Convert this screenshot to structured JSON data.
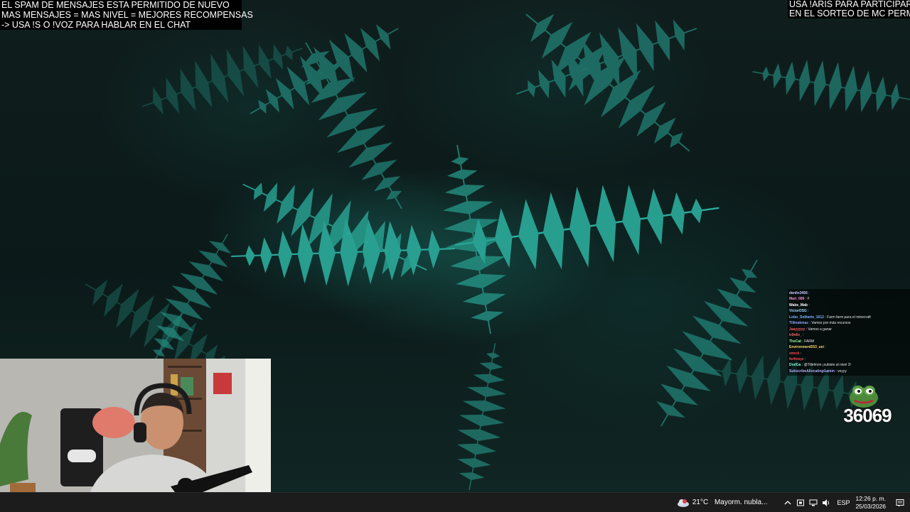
{
  "overlay_left": {
    "lines": [
      "EL SPAM DE MENSAJES ESTA PERMITIDO DE NUEVO",
      "MAS MENSAJES = MAS NIVEL = MEJORES RECOMPENSAS",
      "-> USA !S  O !VOZ PARA HABLAR EN EL CHAT"
    ]
  },
  "overlay_right": {
    "lines": [
      "USA !ARIS PARA PARTICIPAR",
      "EN EL SORTEO DE MC PERMA"
    ]
  },
  "chat": {
    "messages": [
      {
        "user": "danilo3456",
        "text": "",
        "color": "#c9c9ff"
      },
      {
        "user": "Mari_089",
        "text": "F",
        "color": "#ff8ad8"
      },
      {
        "user": "Wabs_Mab",
        "text": "",
        "color": "#ffffff"
      },
      {
        "user": "VictorDSG",
        "text": "",
        "color": "#9fd6ff"
      },
      {
        "user": "Lobo_Solitario_1012",
        "text": "Farm farm para el minecraft",
        "color": "#7ab8ff"
      },
      {
        "user": "Tillinakmac",
        "text": "Vamos por más recursos",
        "color": "#8fa4ff"
      },
      {
        "user": "Jaayyyyy",
        "text": "Vamos a ganar",
        "color": "#ff5a5a"
      },
      {
        "user": "tr0n6x_",
        "text": "",
        "color": "#ff6b6b"
      },
      {
        "user": "TheCat",
        "text": "FARM",
        "color": "#9dff9d"
      },
      {
        "user": "Environment553_uei",
        "text": "",
        "color": "#ffd86b"
      },
      {
        "user": "zmrck",
        "text": "",
        "color": "#ff4d4d"
      },
      {
        "user": "forlinsyz",
        "text": "",
        "color": "#ff4d4d"
      },
      {
        "user": "DodGa",
        "text": "@Tillelmon ¡subiste al nivel 3!",
        "color": "#7fffd4"
      },
      {
        "user": "SubscribeAllocatingGamin",
        "text": "veyyy",
        "color": "#b0b0ff"
      }
    ]
  },
  "counter": {
    "value": "36069"
  },
  "taskbar": {
    "temperature": "21°C",
    "weather_text": "Mayorm. nubla...",
    "language": "ESP",
    "time": "12:26 p. m.",
    "date": "25/03/2026",
    "icons": [
      "chevron-up-icon",
      "security-icon",
      "network-icon",
      "volume-icon",
      "notification-icon"
    ]
  }
}
